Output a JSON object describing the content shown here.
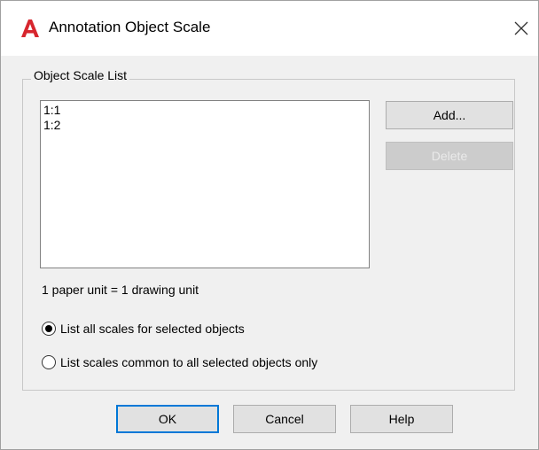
{
  "window": {
    "title": "Annotation Object Scale",
    "app_icon": "autocad-a-icon",
    "close_glyph": "✕"
  },
  "group": {
    "label": "Object Scale List",
    "scales": [
      "1:1",
      "1:2"
    ],
    "unit_text": "1 paper unit = 1 drawing unit"
  },
  "side_buttons": {
    "add_label": "Add...",
    "delete_label": "Delete"
  },
  "options": {
    "list_all_label": "List all scales for selected objects",
    "list_common_label": "List scales common to all selected objects only",
    "selected": "list_all"
  },
  "footer": {
    "ok_label": "OK",
    "cancel_label": "Cancel",
    "help_label": "Help"
  },
  "colors": {
    "accent": "#0078d7",
    "app_icon_red": "#d7262e"
  }
}
